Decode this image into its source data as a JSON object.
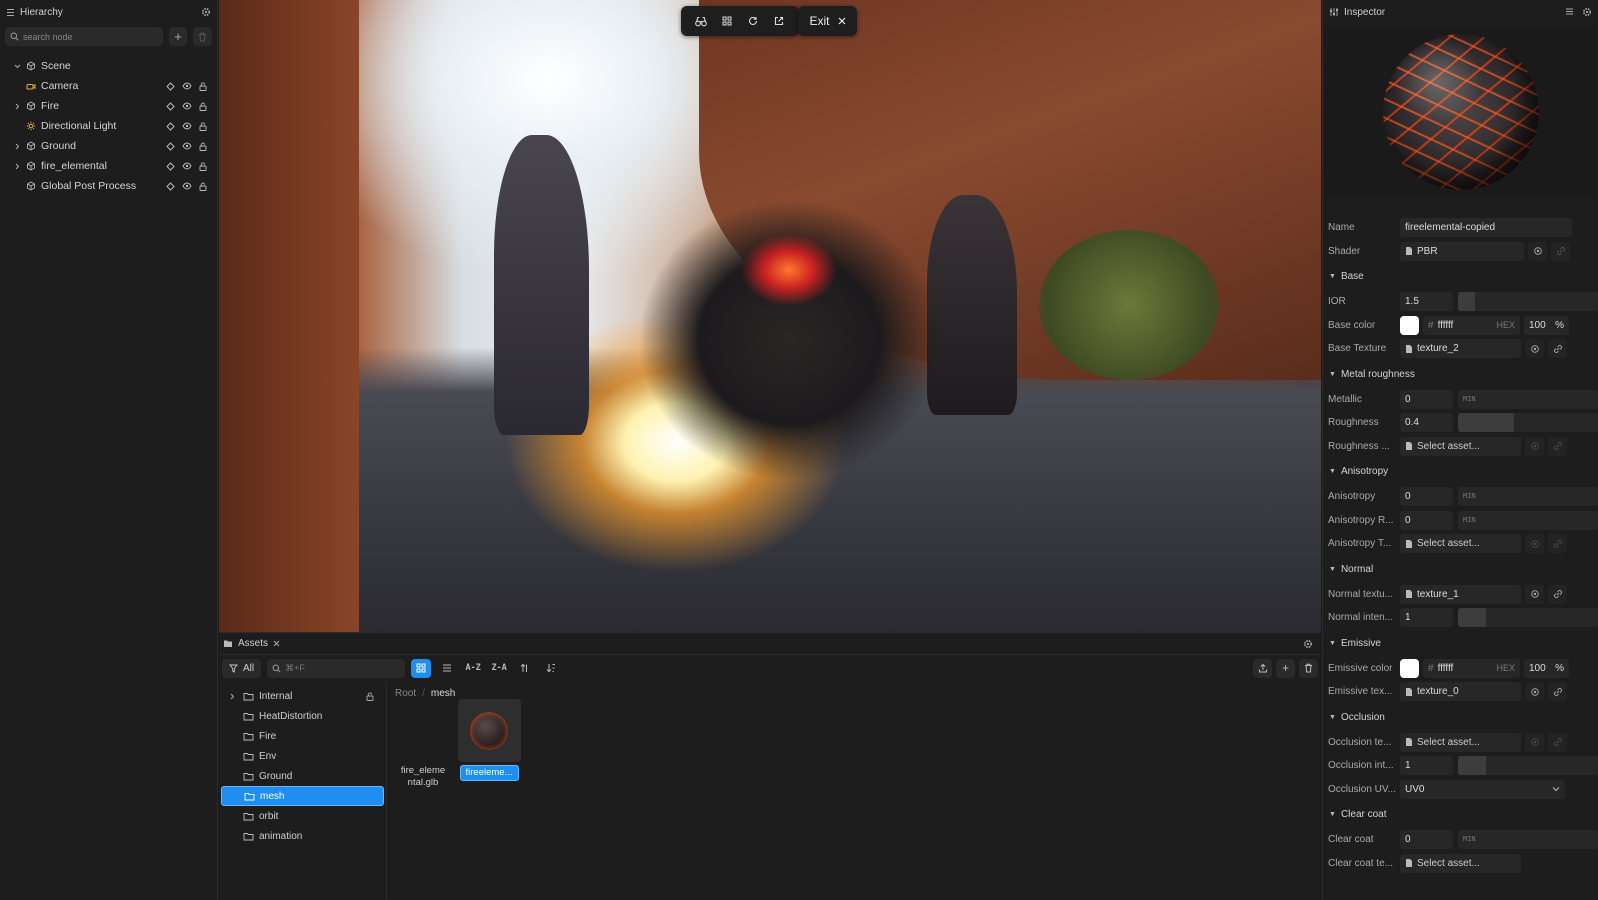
{
  "hierarchy": {
    "title": "Hierarchy",
    "search_placeholder": "search node",
    "nodes": [
      {
        "label": "Scene"
      },
      {
        "label": "Camera"
      },
      {
        "label": "Fire"
      },
      {
        "label": "Directional Light"
      },
      {
        "label": "Ground"
      },
      {
        "label": "fire_elemental"
      },
      {
        "label": "Global Post Process"
      }
    ]
  },
  "viewport": {
    "exit_label": "Exit"
  },
  "assets": {
    "tab_label": "Assets",
    "filter_label": "All",
    "search_placeholder": "⌘+F",
    "sort_az": "A-Z",
    "sort_za": "Z-A",
    "folders": [
      {
        "label": "Internal"
      },
      {
        "label": "HeatDistortion"
      },
      {
        "label": "Fire"
      },
      {
        "label": "Env"
      },
      {
        "label": "Ground"
      },
      {
        "label": "mesh"
      },
      {
        "label": "orbit"
      },
      {
        "label": "animation"
      }
    ],
    "breadcrumb": {
      "root": "Root",
      "sep": "/",
      "current": "mesh"
    },
    "items": [
      {
        "label_line1": "fire_eleme",
        "label_line2": "ntal.glb"
      },
      {
        "label": "fireeleme..."
      }
    ]
  },
  "inspector": {
    "title": "Inspector",
    "name_label": "Name",
    "name_value": "fireelemental-copied",
    "shader_label": "Shader",
    "shader_value": "PBR",
    "sections": {
      "base": "Base",
      "metal": "Metal roughness",
      "aniso": "Anisotropy",
      "normal": "Normal",
      "emissive": "Emissive",
      "occlusion": "Occlusion",
      "clearcoat": "Clear coat"
    },
    "ior": {
      "label": "IOR",
      "value": "1.5",
      "level": 0.12
    },
    "base_color": {
      "label": "Base color",
      "hash": "#",
      "hex": "ffffff",
      "hex_tag": "HEX",
      "opacity": "100",
      "pct": "%"
    },
    "base_texture": {
      "label": "Base Texture",
      "value": "texture_2"
    },
    "metallic": {
      "label": "Metallic",
      "value": "0",
      "min": "MIN"
    },
    "roughness": {
      "label": "Roughness",
      "value": "0.4",
      "level": 0.4
    },
    "roughness_tex": {
      "label": "Roughness ...",
      "value": "Select asset..."
    },
    "anisotropy": {
      "label": "Anisotropy",
      "value": "0",
      "min": "MIN"
    },
    "aniso_r": {
      "label": "Anisotropy R...",
      "value": "0",
      "min": "MIN"
    },
    "aniso_t": {
      "label": "Anisotropy T...",
      "value": "Select asset..."
    },
    "normal_tex": {
      "label": "Normal textu...",
      "value": "texture_1"
    },
    "normal_int": {
      "label": "Normal inten...",
      "value": "1",
      "level": 0.2
    },
    "emissive_color": {
      "label": "Emissive color",
      "hash": "#",
      "hex": "ffffff",
      "hex_tag": "HEX",
      "opacity": "100",
      "pct": "%"
    },
    "emissive_tex": {
      "label": "Emissive tex...",
      "value": "texture_0"
    },
    "occlusion_tex": {
      "label": "Occlusion te...",
      "value": "Select asset..."
    },
    "occlusion_int": {
      "label": "Occlusion int...",
      "value": "1",
      "level": 0.2
    },
    "occlusion_uv": {
      "label": "Occlusion UV...",
      "value": "UV0"
    },
    "clear_coat": {
      "label": "Clear coat",
      "value": "0",
      "min": "MIN"
    },
    "clear_coat_tex": {
      "label": "Clear coat te...",
      "value": "Select asset..."
    }
  }
}
